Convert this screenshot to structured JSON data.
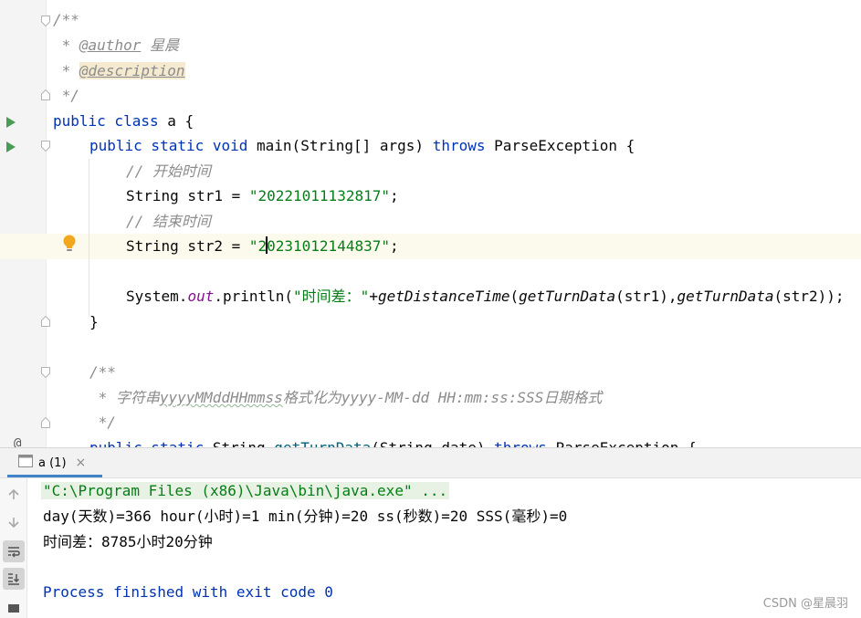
{
  "editor": {
    "lines": {
      "l1": "/**",
      "l2_star": " * ",
      "l2_tag": "@author",
      "l2_text": " 星晨",
      "l3_star": " * ",
      "l3_tag": "@description",
      "l4": " */",
      "l5_kw": "public class",
      "l5_rest": " a {",
      "l6_kw1": "public static void",
      "l6_name": " main(String[] args) ",
      "l6_kw2": "throws",
      "l6_rest": " ParseException {",
      "l7": "// 开始时间",
      "l8_pre": "String str1 = ",
      "l8_str": "\"20221011132817\"",
      "l8_end": ";",
      "l9": "// 结束时间",
      "l10_pre": "String str2 = ",
      "l10_str_a": "\"2",
      "l10_str_b": "0231012144837\"",
      "l10_end": ";",
      "l12_a": "System.",
      "l12_field": "out",
      "l12_b": ".println(",
      "l12_str": "\"时间差：\"",
      "l12_c": "+",
      "l12_m1": "getDistanceTime",
      "l12_d": "(",
      "l12_m2": "getTurnData",
      "l12_e": "(str1),",
      "l12_m3": "getTurnData",
      "l12_f": "(str2));",
      "l13": "}",
      "l15": "/**",
      "l16_a": " * 字符串",
      "l16_b": "yyyyMMddHHmmss",
      "l16_c": "格式化为yyyy-MM-dd HH:mm:ss:SSS日期格式",
      "l17": " */",
      "l18_kw": "public static",
      "l18_a": " String ",
      "l18_name": "getTurnData",
      "l18_b": "(String date) ",
      "l18_kw2": "throws",
      "l18_c": " ParseException {"
    },
    "gutter_at": "@"
  },
  "run": {
    "tab_label": "a (1)",
    "tab_close": "×",
    "console": {
      "command": "\"C:\\Program Files (x86)\\Java\\bin\\java.exe\" ...",
      "line1": "day(天数)=366 hour(小时)=1 min(分钟)=20 ss(秒数)=20 SSS(毫秒)=0",
      "line2": "时间差：8785小时20分钟",
      "line3": "Process finished with exit code 0"
    }
  },
  "watermark": "CSDN @星晨羽",
  "colors": {
    "keyword": "#0033b3",
    "string": "#067d17",
    "comment": "#8c8c8c",
    "field": "#871094",
    "run_icon": "#499c54",
    "bulb": "#f2a81d"
  }
}
